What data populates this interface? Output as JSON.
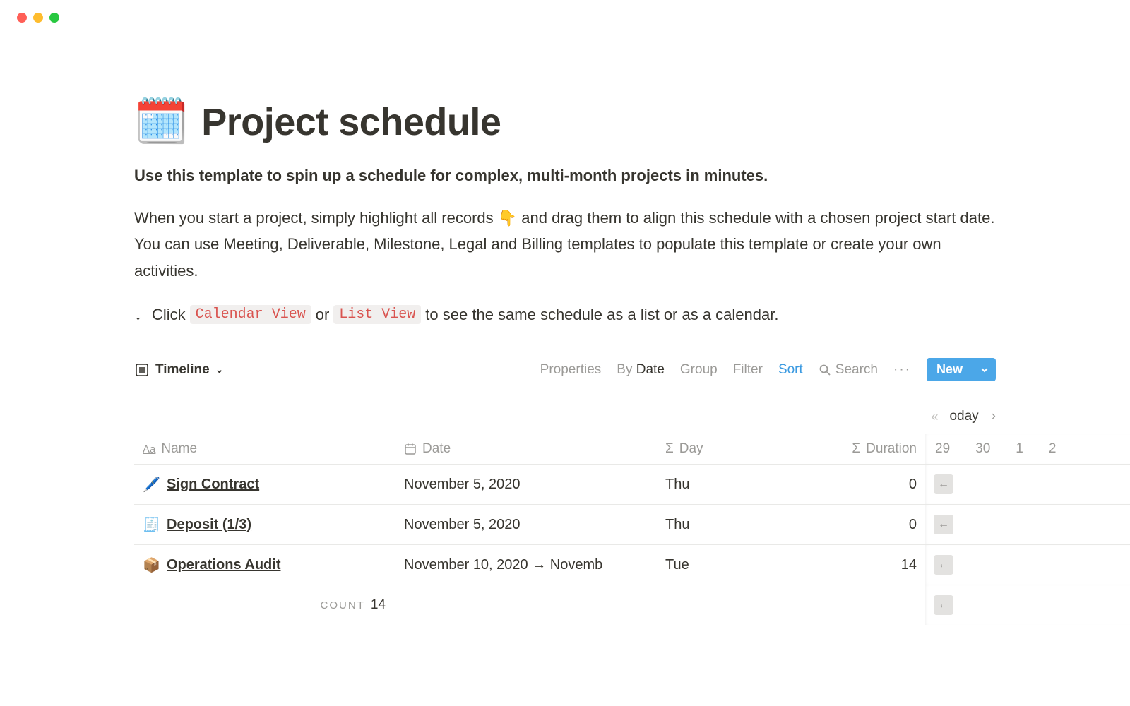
{
  "page": {
    "icon": "🗓️",
    "title": "Project schedule",
    "subtitle": "Use this template to spin up a schedule for complex, multi-month projects in minutes.",
    "body": "When you start a project, simply highlight all records 👇 and drag them to align this schedule with a chosen project start date. You can use Meeting, Deliverable, Milestone, Legal and Billing templates to populate this template or create your own activities."
  },
  "instruction": {
    "arrow": "↓",
    "prefix": "Click",
    "chip1": "Calendar View",
    "mid": "or",
    "chip2": "List View",
    "suffix": "to see the same schedule as a list or as a calendar."
  },
  "toolbar": {
    "view_name": "Timeline",
    "properties": "Properties",
    "by_prefix": "By",
    "by_value": "Date",
    "group": "Group",
    "filter": "Filter",
    "sort": "Sort",
    "search": "Search",
    "more": "···",
    "new_label": "New"
  },
  "timeline_nav": {
    "prev": "«",
    "today": "oday",
    "next": "›",
    "days": [
      "29",
      "30",
      "1",
      "2"
    ]
  },
  "columns": {
    "name": "Name",
    "date": "Date",
    "day": "Day",
    "duration": "Duration"
  },
  "rows": [
    {
      "icon": "🖊️",
      "name": "Sign Contract",
      "date": "November 5, 2020",
      "day": "Thu",
      "duration": "0"
    },
    {
      "icon": "🧾",
      "name": "Deposit (1/3)",
      "date": "November 5, 2020",
      "day": "Thu",
      "duration": "0"
    },
    {
      "icon": "📦",
      "name": "Operations Audit",
      "date": "November 10, 2020 → Novemb",
      "day": "Tue",
      "duration": "14"
    }
  ],
  "footer": {
    "count_label": "COUNT",
    "count_value": "14"
  }
}
